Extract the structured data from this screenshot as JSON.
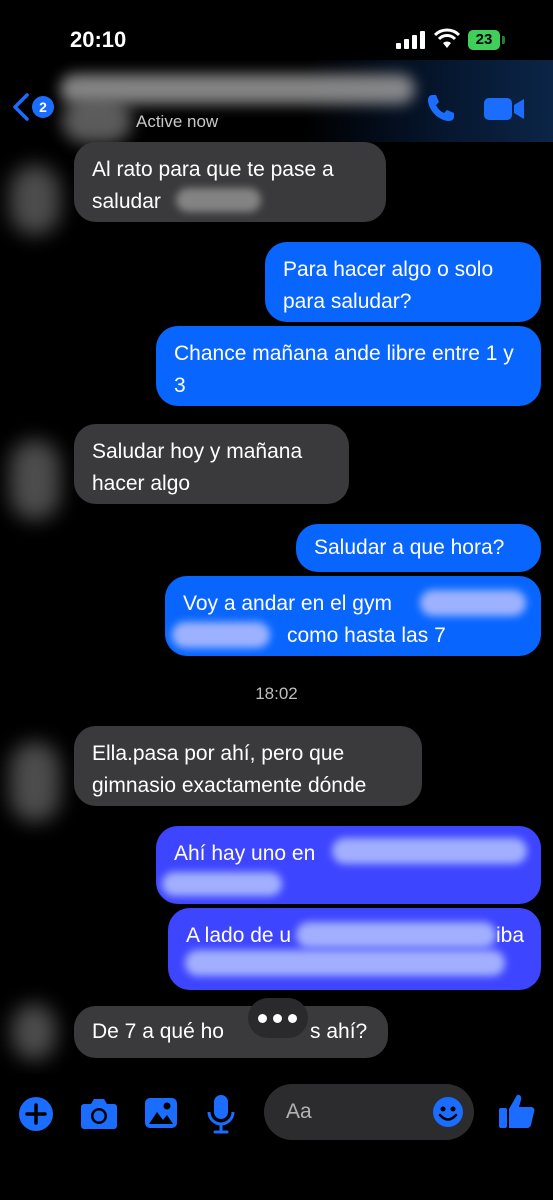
{
  "status_bar": {
    "time": "20:10",
    "battery": "23"
  },
  "header": {
    "unread_badge": "2",
    "status_text": "Active now"
  },
  "messages": {
    "m1": {
      "text": "Al rato para que te pase a saludar"
    },
    "m2": {
      "text": "Para hacer algo o solo para saludar?"
    },
    "m3": {
      "text": "Chance mañana ande libre entre 1 y 3"
    },
    "m4": {
      "text": "Saludar hoy y mañana hacer algo"
    },
    "m5": {
      "text": "Saludar a que hora?"
    },
    "m6": {
      "line1": "Voy a andar en el gym",
      "line2": "como hasta las 7"
    },
    "timestamp": "18:02",
    "m7": {
      "text": "Ella.pasa por ahí, pero que gimnasio exactamente dónde"
    },
    "m8": {
      "text": "Ahí hay uno en"
    },
    "m9": {
      "text": "A lado de u",
      "tail": "iba"
    },
    "m10": {
      "left": "De 7 a qué ho",
      "right": "s ahí?"
    }
  },
  "composer": {
    "placeholder": "Aa",
    "icons": [
      "plus-icon",
      "camera-icon",
      "image-icon",
      "microphone-icon",
      "emoji-icon",
      "thumbs-up-icon"
    ]
  },
  "colors": {
    "outgoing": "#0866ff",
    "incoming": "#3a3a3c",
    "accent": "#1a6dff"
  }
}
